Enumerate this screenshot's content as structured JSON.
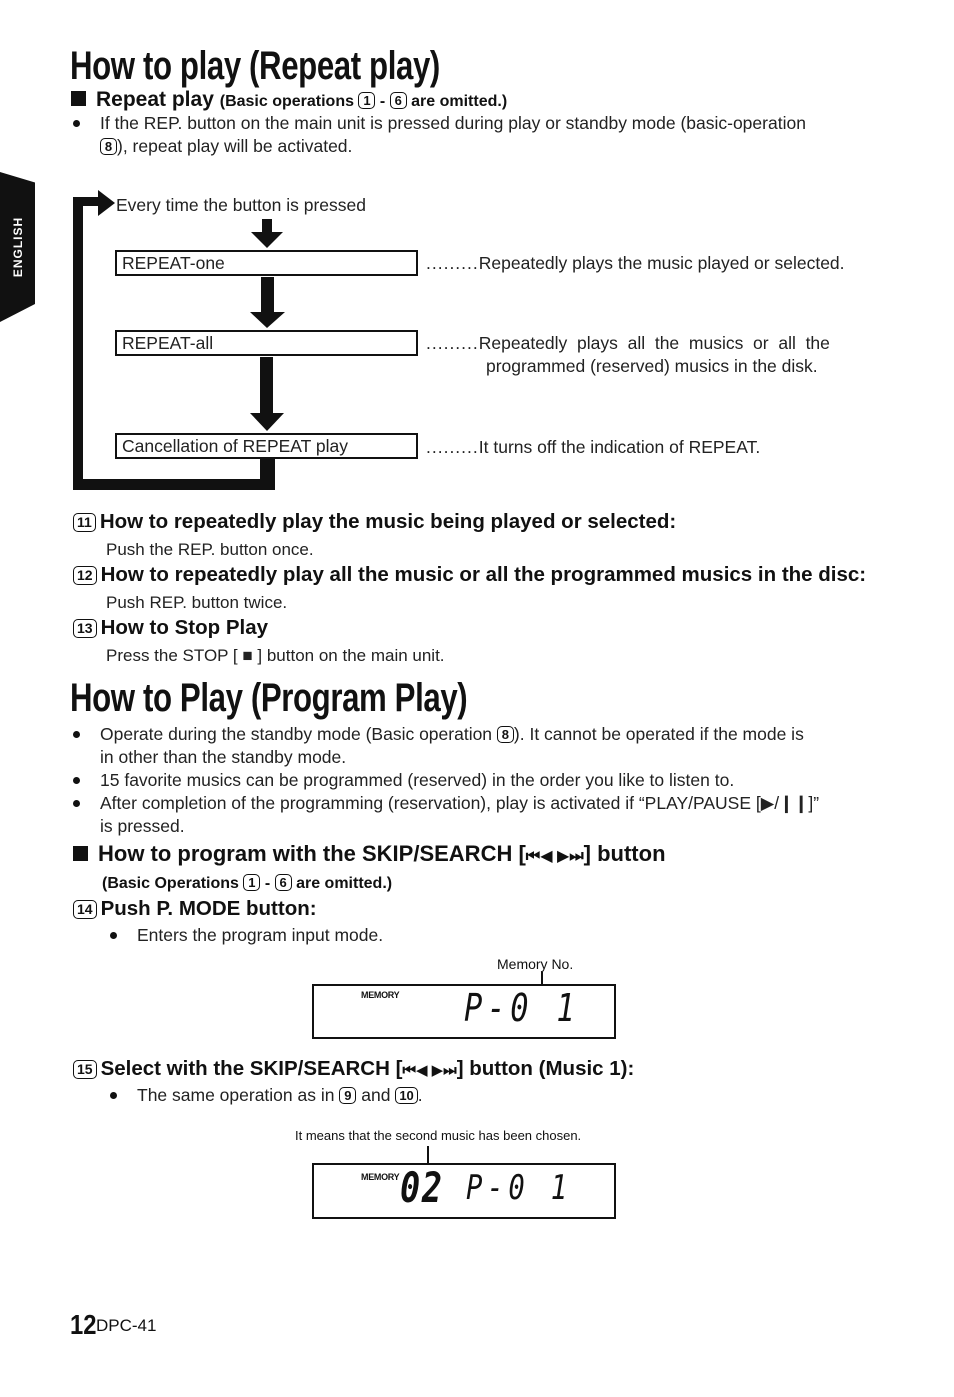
{
  "side_tab": {
    "label": "ENGLISH"
  },
  "repeat_section": {
    "title": "How to play (Repeat play)",
    "subheading": {
      "label": "Repeat play",
      "note_prefix": "(Basic operations",
      "note_from": "1",
      "note_dash": "-",
      "note_to": "6",
      "note_suffix": "are omitted.)"
    },
    "intro_line1": "If the REP. button on the main unit is pressed during play or standby mode (basic-operation",
    "intro_ref": "8",
    "intro_line2": "), repeat play will be activated.",
    "diagram": {
      "caption": "Every time the button is pressed",
      "states": [
        {
          "label": "REPEAT-one",
          "dots": ".........",
          "description": "Repeatedly plays the music played or selected.",
          "description2": ""
        },
        {
          "label": "REPEAT-all",
          "dots": ".........",
          "description": "Repeatedly  plays  all  the  musics  or  all  the",
          "description2": "programmed (reserved) musics in the disk."
        },
        {
          "label": "Cancellation of REPEAT play",
          "dots": ".........",
          "description": "It turns off the indication of REPEAT.",
          "description2": ""
        }
      ]
    },
    "steps": [
      {
        "num": "11",
        "heading": "How to repeatedly play the music being played or selected:",
        "text": "Push the REP. button once."
      },
      {
        "num": "12",
        "heading": "How to repeatedly play all the music or all the programmed musics in the disc:",
        "text": "Push REP. button twice."
      },
      {
        "num": "13",
        "heading": "How to Stop Play",
        "text_before": "Press the STOP [",
        "text_icon": "■",
        "text_after": "] button on the main unit."
      }
    ]
  },
  "program_section": {
    "title": "How to Play (Program Play)",
    "bullets": [
      {
        "line1_before": "Operate during the standby mode (Basic operation",
        "ref": "8",
        "line1_after": "). It cannot be operated if the mode is",
        "line2": "in other than the standby mode."
      },
      {
        "line1": "15 favorite musics can be programmed (reserved) in the order you like to listen to."
      },
      {
        "line1": "After completion of the programming (reservation), play is activated if “PLAY/PAUSE [▶/❙❙]”",
        "line2": "is pressed."
      }
    ],
    "subheading": {
      "label_before": "How to program with the SKIP/SEARCH [",
      "icons": "⏮◀ ▶⏭",
      "label_after": "] button",
      "note_prefix": "(Basic Operations",
      "note_from": "1",
      "note_dash": "-",
      "note_to": "6",
      "note_suffix": "are omitted.)"
    },
    "step14": {
      "num": "14",
      "heading": "Push P. MODE button:",
      "bullet": "Enters the program input mode."
    },
    "display1": {
      "caption": "Memory No.",
      "label": "MEMORY",
      "readout": "P-0 1"
    },
    "step15": {
      "num": "15",
      "heading_before": "Select with the SKIP/SEARCH [",
      "icons": "⏮◀ ▶⏭",
      "heading_after": "] button (Music 1):",
      "bullet_before": "The same operation as in",
      "ref1": "9",
      "bullet_mid": "and",
      "ref2": "10",
      "bullet_after": "."
    },
    "display2": {
      "caption": "It means that the second music has been chosen.",
      "label": "MEMORY",
      "track": "02",
      "readout": "P-0 1"
    }
  },
  "footer": {
    "page_number": "12",
    "model": "DPC-41"
  }
}
